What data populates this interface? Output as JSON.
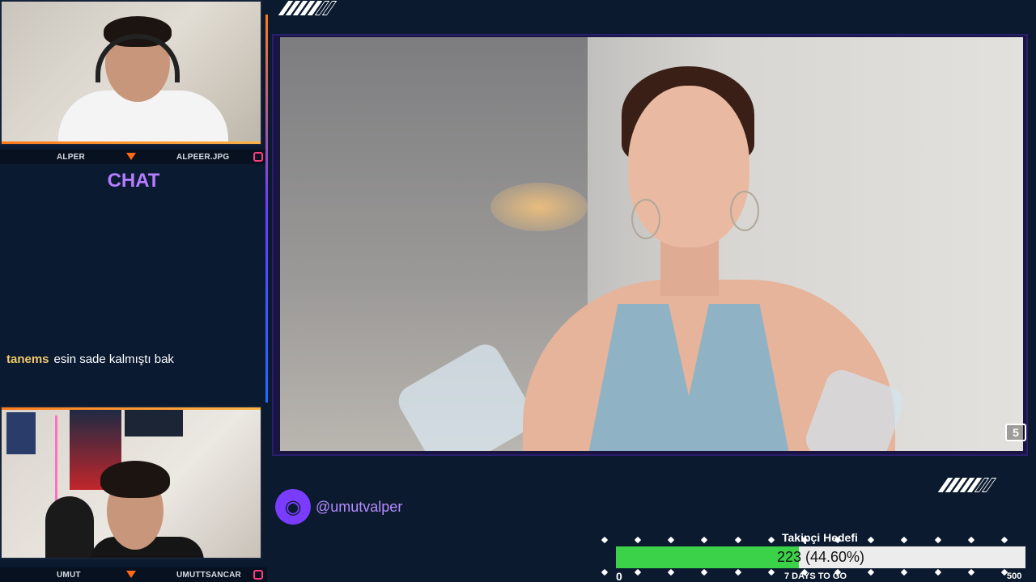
{
  "streamer_top": {
    "name": "ALPER",
    "social": "ALPEER.JPG"
  },
  "streamer_bottom": {
    "name": "UMUT",
    "social": "UMUTTSANCAR"
  },
  "chat": {
    "title": "CHAT",
    "messages": [
      {
        "user": "tanems",
        "text": "esin sade kalmıştı bak"
      }
    ]
  },
  "video": {
    "channel_badge": "5"
  },
  "handle": {
    "text": "@umutvalper",
    "icon": "globe-icon"
  },
  "follower_goal": {
    "title": "Takipçi Hedefi",
    "current": 223,
    "target": 500,
    "min_label": "0",
    "max_label": "500",
    "value_label": "223 (44.60%)",
    "percent": 44.6,
    "days_label": "7 DAYS TO GO",
    "fill_color": "#3bd24a"
  },
  "colors": {
    "accent_purple": "#b47cff",
    "accent_orange": "#ff6a13",
    "background": "#0b1a2e"
  }
}
